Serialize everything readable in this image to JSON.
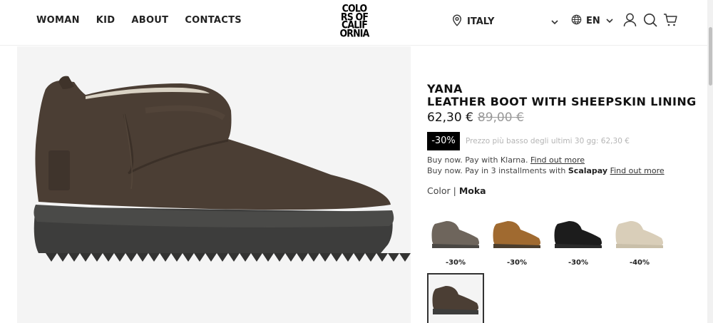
{
  "header": {
    "nav": [
      "WOMAN",
      "KID",
      "ABOUT",
      "CONTACTS"
    ],
    "logo_lines": [
      "COLO",
      "RS OF",
      "CALIF",
      "ORNIA"
    ],
    "country": "ITALY",
    "language": "EN"
  },
  "product": {
    "brand": "YANA",
    "title": "LEATHER BOOT WITH SHEEPSKIN LINING",
    "price": "62,30 €",
    "old_price": "89,00 €",
    "discount": "-30%",
    "lowest_price_note": "Prezzo più basso degli ultimi 30 gg: 62,30 €",
    "klarna": {
      "text": "Buy now. Pay with Klarna.",
      "link": "Find out more"
    },
    "scalapay": {
      "text": "Buy now. Pay in 3 installments with",
      "brand": "Scalapay",
      "link": "Find out more"
    },
    "color_label": "Color |",
    "color_value": "Moka"
  },
  "variants": [
    {
      "name": "grey-brown",
      "discount": "-30%",
      "color": "#6e655c"
    },
    {
      "name": "chestnut",
      "discount": "-30%",
      "color": "#a06a30"
    },
    {
      "name": "black",
      "discount": "-30%",
      "color": "#1c1c1c"
    },
    {
      "name": "sand",
      "discount": "-40%",
      "color": "#d9ceb9"
    }
  ],
  "colors": {
    "boot_main": "#4a3d33",
    "sole": "#3e3e3d",
    "accent": "#000000"
  }
}
